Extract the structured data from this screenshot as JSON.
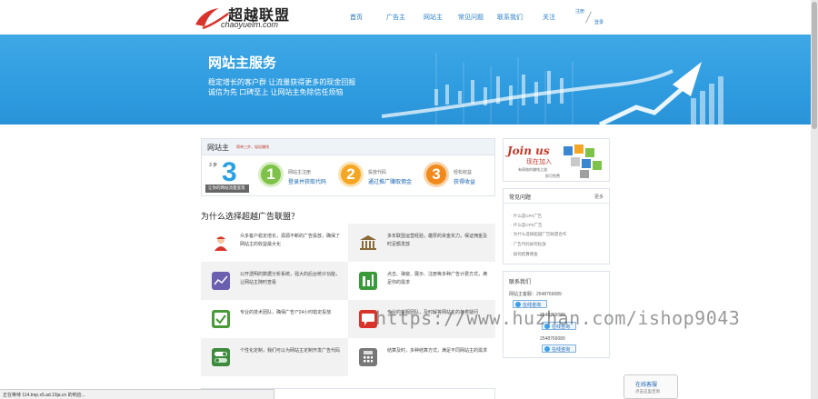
{
  "header": {
    "logo_cn": "超越联盟",
    "logo_en": "chaoyuelm.com",
    "nav": [
      "首页",
      "广告主",
      "网站主",
      "常见问题",
      "联系我们",
      "关注"
    ],
    "login": "注册",
    "register": "登录"
  },
  "banner": {
    "title": "网站主服务",
    "line1": "稳定增长的客户群 让流量获得更多的现金回报",
    "line2": "诚信为先 口碑至上 让网站主免除信任烦恼"
  },
  "steps": {
    "title": "网站主",
    "desc": "简单三步，轻松赚钱",
    "big_label": "3 步",
    "big_num": "3",
    "big_bar": "让你的网站流量变现",
    "items": [
      {
        "num": "1",
        "line1": "网站主注册",
        "line2": "登录并获取代码",
        "color": "#7ec24a"
      },
      {
        "num": "2",
        "line1": "投放代码",
        "line2": "通过推广赚取佣金",
        "color": "#f5a623"
      },
      {
        "num": "3",
        "line1": "轻松收益",
        "line2": "获得收益",
        "color": "#f08a1c"
      }
    ]
  },
  "why": {
    "title": "为什么选择超越广告联盟？",
    "features": [
      {
        "icon": "user-icon",
        "text": "众多客户稳定增长，源源不断的广告投放，确保了网站主的收益最大化",
        "color": "#d9342b"
      },
      {
        "icon": "bank-icon",
        "text": "多年联盟运营经验，雄厚的资金实力，保证佣金及时足额发放",
        "color": "#8a6a3a"
      },
      {
        "icon": "chart-icon",
        "text": "公开透明的数据分析系统，强大的后台统计功能，让网站主随时查看",
        "color": "#6b5fb0"
      },
      {
        "icon": "bar-chart-icon",
        "text": "点击、弹窗、展示、注册等多种广告计费方式，满足你的需求",
        "color": "#3a9a3a"
      },
      {
        "icon": "check-icon",
        "text": "专业的技术团队，确保广告7*24小时稳定投放",
        "color": "#4b9a3a"
      },
      {
        "icon": "chat-icon",
        "text": "专业的客服团队，及时解答网站主的各类疑问",
        "color": "#d9342b"
      },
      {
        "icon": "toggle-icon",
        "text": "个性化定制，我们可以为网站主定制开发广告代码",
        "color": "#3e8a3e"
      },
      {
        "icon": "calculator-icon",
        "text": "结算及时，多种结算方式，满足不同网站主的需求",
        "color": "#777777"
      }
    ]
  },
  "joinus": {
    "en": "Join us",
    "cn": "现在加入",
    "line1": "有网络的赚钱之道",
    "line2": "即可免费"
  },
  "faq": {
    "title": "常见问题",
    "more": "更多",
    "items": [
      "· 什么是CPA广告",
      "· 什么是CPS广告",
      "· 为什么选择超越广告联盟合作",
      "· 广告代码如何投放",
      "· 如何结算佣金"
    ]
  },
  "contact": {
    "title": "联系我们",
    "line1": "网站主客服：2548769089",
    "line2": "2548769089",
    "line3": "2548769089",
    "qq_label": "在线咨询"
  },
  "watermark": "https://www.huzhan.com/ishop9043",
  "float": {
    "a": "在线客服",
    "b": "点击这里咨询"
  },
  "status": "正在等待 114.tmp.x5.ad.19ja.cn 的响应..."
}
